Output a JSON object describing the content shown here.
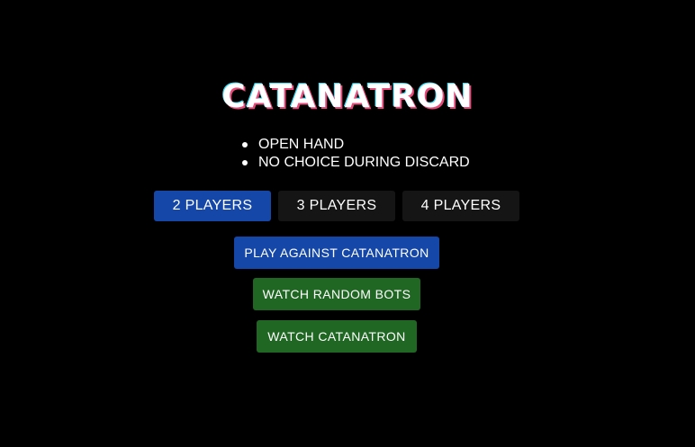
{
  "title": "CATANATRON",
  "rules": [
    "OPEN HAND",
    "NO CHOICE DURING DISCARD"
  ],
  "players": {
    "options": [
      "2 PLAYERS",
      "3 PLAYERS",
      "4 PLAYERS"
    ],
    "selected": "2 PLAYERS"
  },
  "actions": {
    "play_against": "PLAY AGAINST CATANATRON",
    "watch_random": "WATCH RANDOM BOTS",
    "watch_catanatron": "WATCH CATANATRON"
  },
  "colors": {
    "background": "#000000",
    "primary": "#1547a8",
    "success": "#1f6722",
    "unselected": "#151515"
  }
}
